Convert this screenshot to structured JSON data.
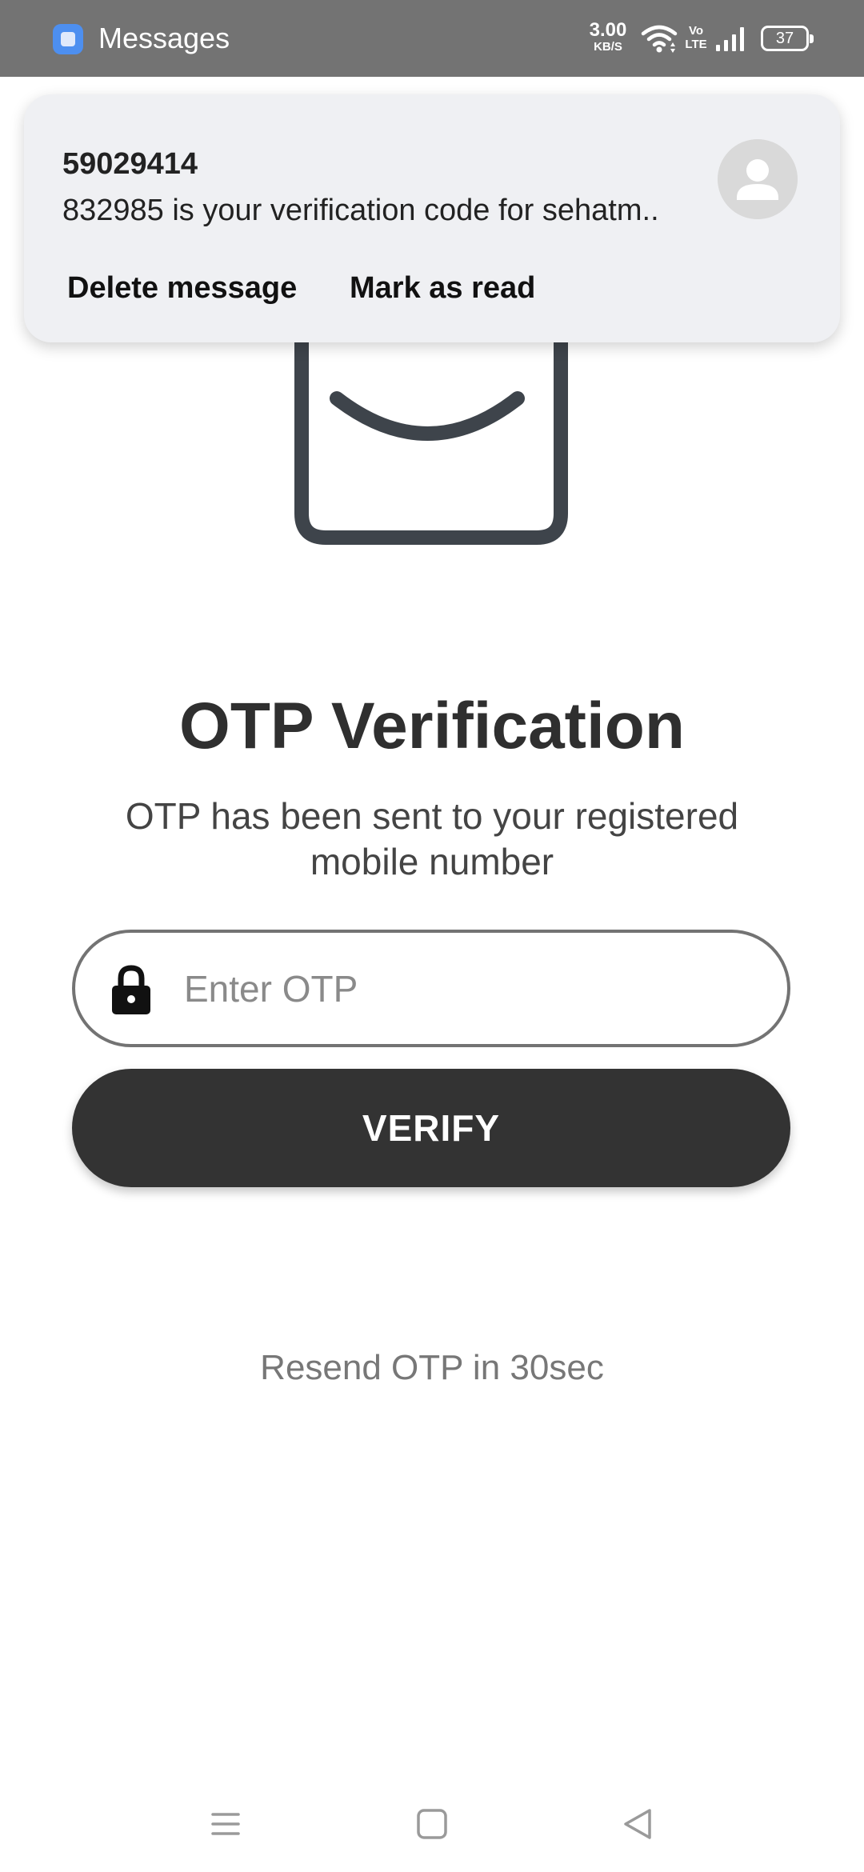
{
  "status_bar": {
    "app_name": "Messages",
    "app_icon": "messages-app-icon",
    "network_speed": "3.00",
    "network_speed_unit": "KB/S",
    "volte_top": "Vo",
    "volte_bottom": "LTE",
    "wifi_icon": "wifi-icon",
    "signal_icon": "cellular-signal-icon",
    "battery_level": "37"
  },
  "notification": {
    "sender": "59029414",
    "body": "832985 is your verification code for sehatm..",
    "avatar_icon": "contact-avatar-icon",
    "actions": [
      "Delete message",
      "Mark as read"
    ]
  },
  "hero": {
    "illustration": "envelope-illustration",
    "accent_color": "#2ecfae"
  },
  "otp": {
    "title": "OTP Verification",
    "subtitle": "OTP has been sent to your registered mobile number",
    "input_placeholder": "Enter OTP",
    "input_value": "",
    "input_icon": "lock-icon",
    "verify_label": "VERIFY",
    "resend_text": "Resend OTP in 30sec"
  },
  "nav_bar": {
    "icons": [
      "menu-icon",
      "home-icon",
      "back-icon"
    ]
  },
  "colors": {
    "status_bar": "#737373",
    "primary_dark": "#333333",
    "notification_bg": "#eff0f3",
    "field_border": "#737373"
  }
}
